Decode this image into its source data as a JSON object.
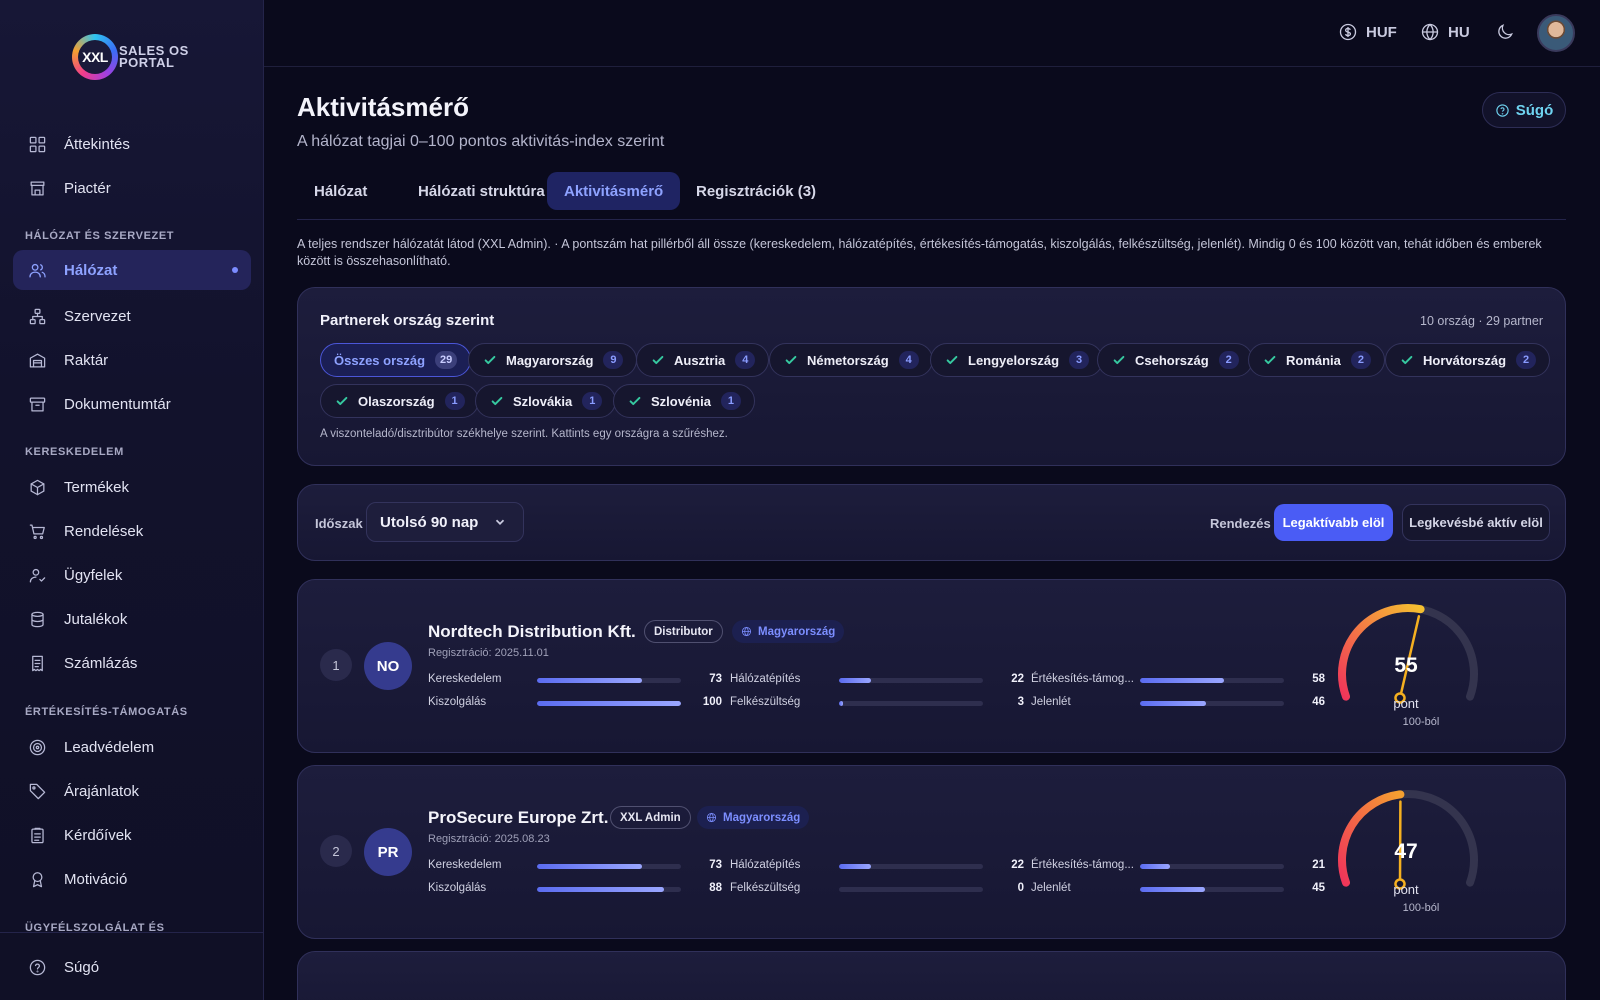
{
  "logo": {
    "mark": "XXL",
    "line1": "SALES OS",
    "line2": "PORTAL"
  },
  "sidebar": {
    "items": [
      {
        "label": "Áttekintés",
        "icon": "grid-icon"
      },
      {
        "label": "Piactér",
        "icon": "store-icon"
      },
      {
        "label": "Hálózat",
        "icon": "users-icon"
      },
      {
        "label": "Szervezet",
        "icon": "org-chart-icon"
      },
      {
        "label": "Raktár",
        "icon": "warehouse-icon"
      },
      {
        "label": "Dokumentumtár",
        "icon": "archive-icon"
      },
      {
        "label": "Termékek",
        "icon": "box-icon"
      },
      {
        "label": "Rendelések",
        "icon": "cart-icon"
      },
      {
        "label": "Ügyfelek",
        "icon": "user-check-icon"
      },
      {
        "label": "Jutalékok",
        "icon": "database-icon"
      },
      {
        "label": "Számlázás",
        "icon": "receipt-icon"
      },
      {
        "label": "Leadvédelem",
        "icon": "target-icon"
      },
      {
        "label": "Árajánlatok",
        "icon": "tag-icon"
      },
      {
        "label": "Kérdőívek",
        "icon": "clipboard-icon"
      },
      {
        "label": "Motiváció",
        "icon": "award-icon"
      }
    ],
    "sections": [
      "HÁLÓZAT ÉS SZERVEZET",
      "KERESKEDELEM",
      "ÉRTÉKESÍTÉS-TÁMOGATÁS",
      "ÜGYFÉLSZOLGÁLAT ÉS"
    ],
    "footer_help": "Súgó",
    "active_item": "Hálózat"
  },
  "topbar": {
    "currency": "HUF",
    "language": "HU",
    "theme_icon": "moon-icon",
    "avatar_icon": "user-avatar"
  },
  "page": {
    "title": "Aktivitásmérő",
    "subtitle": "A hálózat tagjai 0–100 pontos aktivitás-index szerint",
    "help_label": "Súgó",
    "description": "A teljes rendszer hálózatát látod (XXL Admin). · A pontszám hat pillérből áll össze (kereskedelem, hálózatépítés, értékesítés-támogatás, kiszolgálás, felkészültség, jelenlét). Mindig 0 és 100 között van, tehát időben és emberek között is összehasonlítható."
  },
  "tabs": [
    {
      "label": "Hálózat"
    },
    {
      "label": "Hálózati struktúra"
    },
    {
      "label": "Aktivitásmérő"
    },
    {
      "label": "Regisztrációk (3)"
    }
  ],
  "countries": {
    "title": "Partnerek ország szerint",
    "meta": "10 ország · 29 partner",
    "note": "A viszonteladó/disztribútor székhelye szerint. Kattints egy országra a szűréshez.",
    "chips": [
      {
        "label": "Összes ország",
        "count": "29"
      },
      {
        "label": "Magyarország",
        "count": "9"
      },
      {
        "label": "Ausztria",
        "count": "4"
      },
      {
        "label": "Németország",
        "count": "4"
      },
      {
        "label": "Lengyelország",
        "count": "3"
      },
      {
        "label": "Csehország",
        "count": "2"
      },
      {
        "label": "Románia",
        "count": "2"
      },
      {
        "label": "Horvátország",
        "count": "2"
      },
      {
        "label": "Olaszország",
        "count": "1"
      },
      {
        "label": "Szlovákia",
        "count": "1"
      },
      {
        "label": "Szlovénia",
        "count": "1"
      }
    ]
  },
  "filters": {
    "period_label": "Időszak",
    "period_value": "Utolsó 90 nap",
    "sort_label": "Rendezés",
    "sort_most": "Legaktívabb elöl",
    "sort_least": "Legkevésbé aktív elöl"
  },
  "partners": [
    {
      "rank": "1",
      "initials": "NO",
      "name": "Nordtech Distribution Kft.",
      "role": "Distributor",
      "country": "Magyarország",
      "registered": "Regisztráció: 2025.11.01",
      "score": 55,
      "score_text": "55",
      "unit": "pont",
      "of": "100-ból",
      "metrics": [
        {
          "label": "Kereskedelem",
          "value": 73,
          "text": "73"
        },
        {
          "label": "Hálózatépítés",
          "value": 22,
          "text": "22"
        },
        {
          "label": "Értékesítés-támog...",
          "value": 58,
          "text": "58"
        },
        {
          "label": "Kiszolgálás",
          "value": 100,
          "text": "100"
        },
        {
          "label": "Felkészültség",
          "value": 3,
          "text": "3"
        },
        {
          "label": "Jelenlét",
          "value": 46,
          "text": "46"
        }
      ]
    },
    {
      "rank": "2",
      "initials": "PR",
      "name": "ProSecure Europe Zrt.",
      "role": "XXL Admin",
      "country": "Magyarország",
      "registered": "Regisztráció: 2025.08.23",
      "score": 47,
      "score_text": "47",
      "unit": "pont",
      "of": "100-ból",
      "metrics": [
        {
          "label": "Kereskedelem",
          "value": 73,
          "text": "73"
        },
        {
          "label": "Hálózatépítés",
          "value": 22,
          "text": "22"
        },
        {
          "label": "Értékesítés-támog...",
          "value": 21,
          "text": "21"
        },
        {
          "label": "Kiszolgálás",
          "value": 88,
          "text": "88"
        },
        {
          "label": "Felkészültség",
          "value": 0,
          "text": "0"
        },
        {
          "label": "Jelenlét",
          "value": 45,
          "text": "45"
        }
      ]
    }
  ],
  "colors": {
    "accent": "#4a5cf5",
    "active_text": "#8ea2ff",
    "check": "#36c9a0",
    "gauge_start": "#f0345a",
    "gauge_end": "#f5c030",
    "gauge_track": "#34344e"
  }
}
